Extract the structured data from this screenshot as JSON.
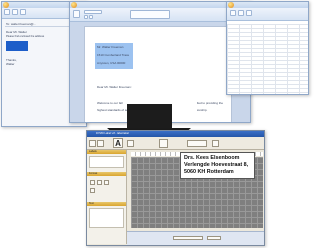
{
  "label_card": {
    "line1": "Drs. Kees Elsenboom",
    "line2": "Verlengde Hoevestraat 8,",
    "line3": "5060 KH  Rotterdam"
  },
  "word_doc": {
    "address_lines": [
      "Mr. Walter Freeman",
      "1510 Cumberland Trace",
      "Anytown, USA 00000"
    ],
    "salutation": "Dear Mr. Walter Freeman:",
    "body_left": "Welcome to our fall",
    "body_left2": "highest standards of ser",
    "body_right": "lled to providing the",
    "body_right2": "ionship."
  },
  "email_body": {
    "to": "To: walter.freeman@...",
    "greeting": "Dear Mr. Walter",
    "line": "Please find enclosed the address",
    "sign": "Thanks,",
    "name": "Walter"
  },
  "label_app": {
    "title": "DYMO Label v.8 - label.label",
    "panel1": "Labels",
    "panel2": "Format",
    "panel3": "Text"
  }
}
